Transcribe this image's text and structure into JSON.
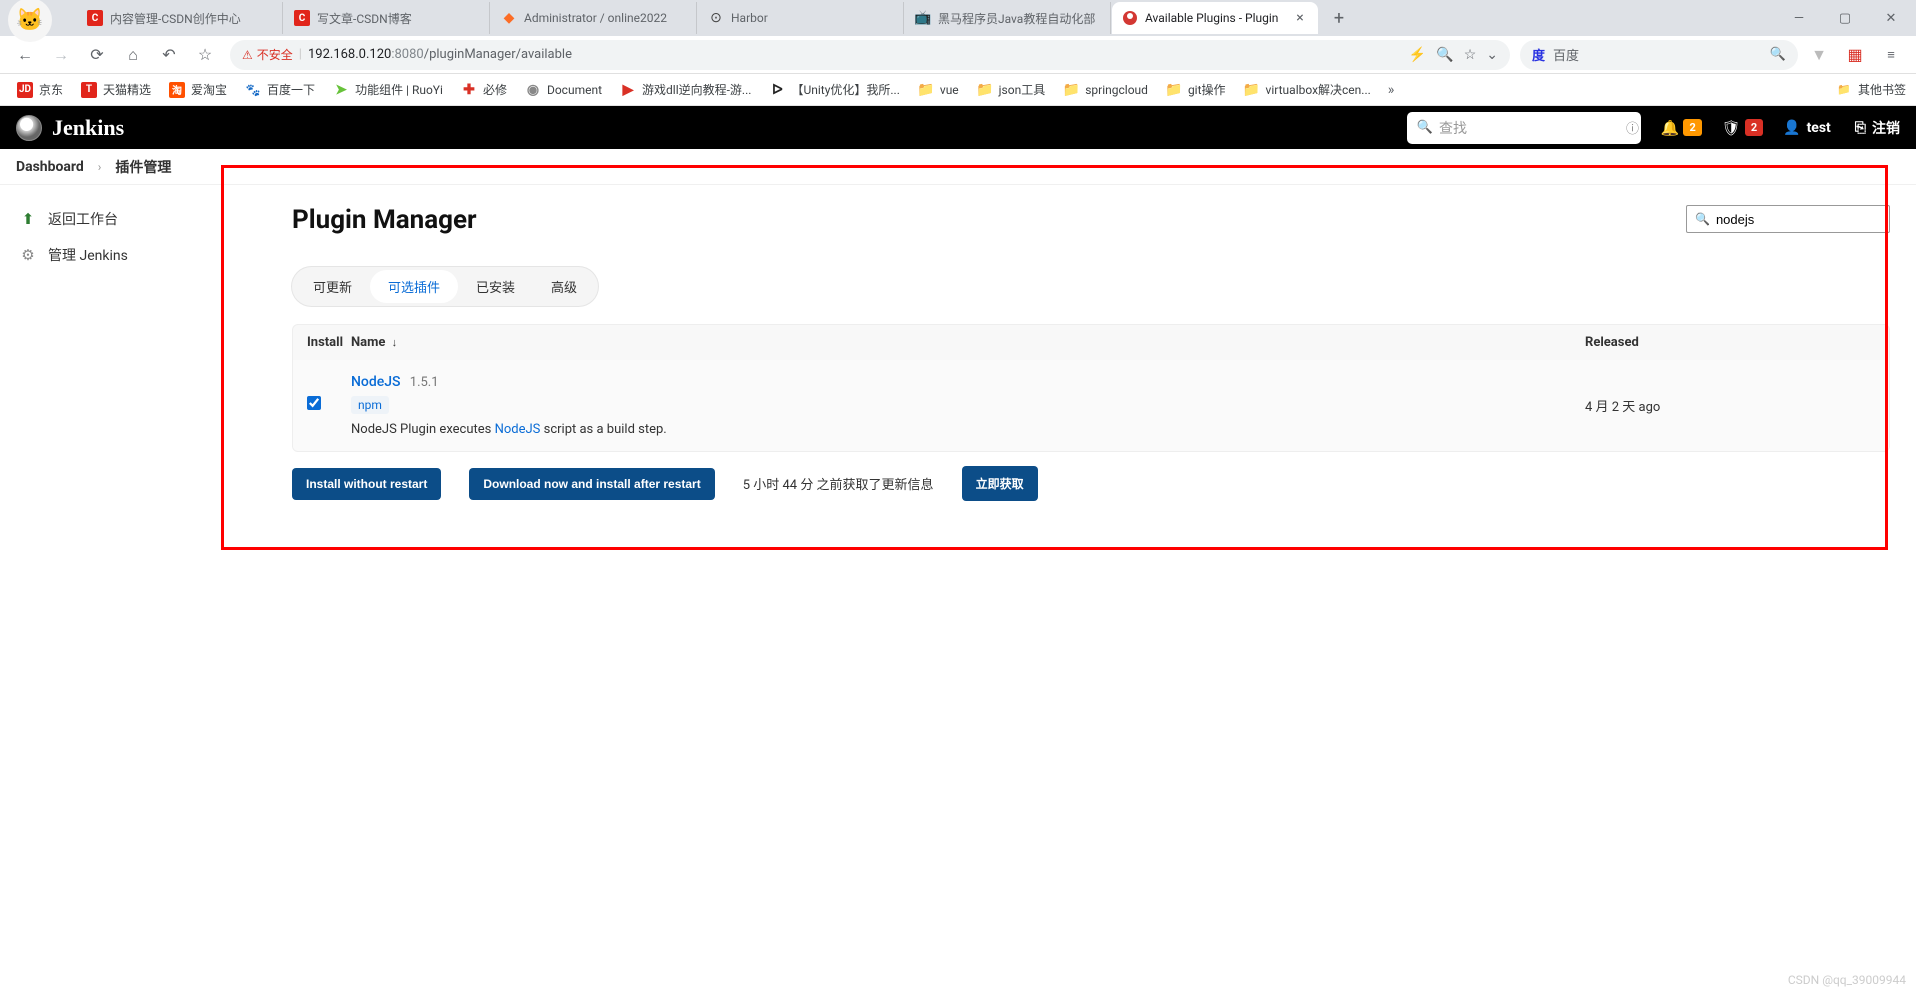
{
  "browser": {
    "tabs": [
      {
        "title": "内容管理-CSDN创作中心",
        "favicon": "C"
      },
      {
        "title": "写文章-CSDN博客",
        "favicon": "C"
      },
      {
        "title": "Administrator / online2022",
        "favicon": "gitlab"
      },
      {
        "title": "Harbor",
        "favicon": "harbor"
      },
      {
        "title": "黑马程序员Java教程自动化部",
        "favicon": "bili"
      },
      {
        "title": "Available Plugins - Plugin",
        "favicon": "jenkins",
        "active": true
      }
    ],
    "new_tab": "+",
    "toolbar": {
      "insecure_label": "不安全",
      "url_host": "192.168.0.120",
      "url_port": ":8080",
      "url_path": "/pluginManager/available",
      "search_engine_icon": "度",
      "search_placeholder": "百度"
    },
    "bookmarks": [
      {
        "icon": "JD",
        "label": "京东",
        "cls": "fc-jd"
      },
      {
        "icon": "T",
        "label": "天猫精选",
        "cls": "fc-tmall"
      },
      {
        "icon": "淘",
        "label": "爱淘宝",
        "cls": "fc-tao"
      },
      {
        "icon": "🐾",
        "label": "百度一下",
        "cls": "fc-baidu"
      },
      {
        "icon": "➤",
        "label": "功能组件 | RuoYi",
        "cls": "fc-ruoyi"
      },
      {
        "icon": "✚",
        "label": "必修",
        "cls": "fc-plus"
      },
      {
        "icon": "◉",
        "label": "Document",
        "cls": "fc-doc"
      },
      {
        "icon": "▶",
        "label": "游戏dll逆向教程-游...",
        "cls": "fc-game"
      },
      {
        "icon": "ᐅ",
        "label": "【Unity优化】我所...",
        "cls": "fc-unity"
      },
      {
        "icon": "📁",
        "label": "vue",
        "cls": "fc-folder"
      },
      {
        "icon": "📁",
        "label": "json工具",
        "cls": "fc-folder"
      },
      {
        "icon": "📁",
        "label": "springcloud",
        "cls": "fc-folder"
      },
      {
        "icon": "📁",
        "label": "git操作",
        "cls": "fc-folder"
      },
      {
        "icon": "📁",
        "label": "virtualbox解决cen...",
        "cls": "fc-folder"
      }
    ],
    "bookmarks_other": "其他书签"
  },
  "jenkins": {
    "brand": "Jenkins",
    "search_placeholder": "查找",
    "notifications_badge": "2",
    "alerts_badge": "2",
    "user": "test",
    "logout": "注销"
  },
  "breadcrumb": {
    "dashboard": "Dashboard",
    "current": "插件管理"
  },
  "sidebar": {
    "items": [
      {
        "icon": "⬆",
        "label": "返回工作台",
        "color": "#2e7d32"
      },
      {
        "icon": "⚙",
        "label": "管理 Jenkins",
        "color": "#888"
      }
    ]
  },
  "page": {
    "title": "Plugin Manager",
    "filter_value": "nodejs",
    "tabs": [
      {
        "label": "可更新"
      },
      {
        "label": "可选插件",
        "active": true
      },
      {
        "label": "已安装"
      },
      {
        "label": "高级"
      }
    ],
    "table": {
      "head_install": "Install",
      "head_name": "Name",
      "head_released": "Released",
      "rows": [
        {
          "checked": true,
          "name": "NodeJS",
          "version": "1.5.1",
          "tag": "npm",
          "desc_pre": "NodeJS Plugin executes ",
          "desc_link": "NodeJS",
          "desc_post": " script as a build step.",
          "released": "4 月 2 天 ago"
        }
      ]
    },
    "actions": {
      "install_no_restart": "Install without restart",
      "download_restart": "Download now and install after restart",
      "update_info": "5 小时 44 分 之前获取了更新信息",
      "fetch_now": "立即获取"
    }
  },
  "watermark": "CSDN @qq_39009944"
}
